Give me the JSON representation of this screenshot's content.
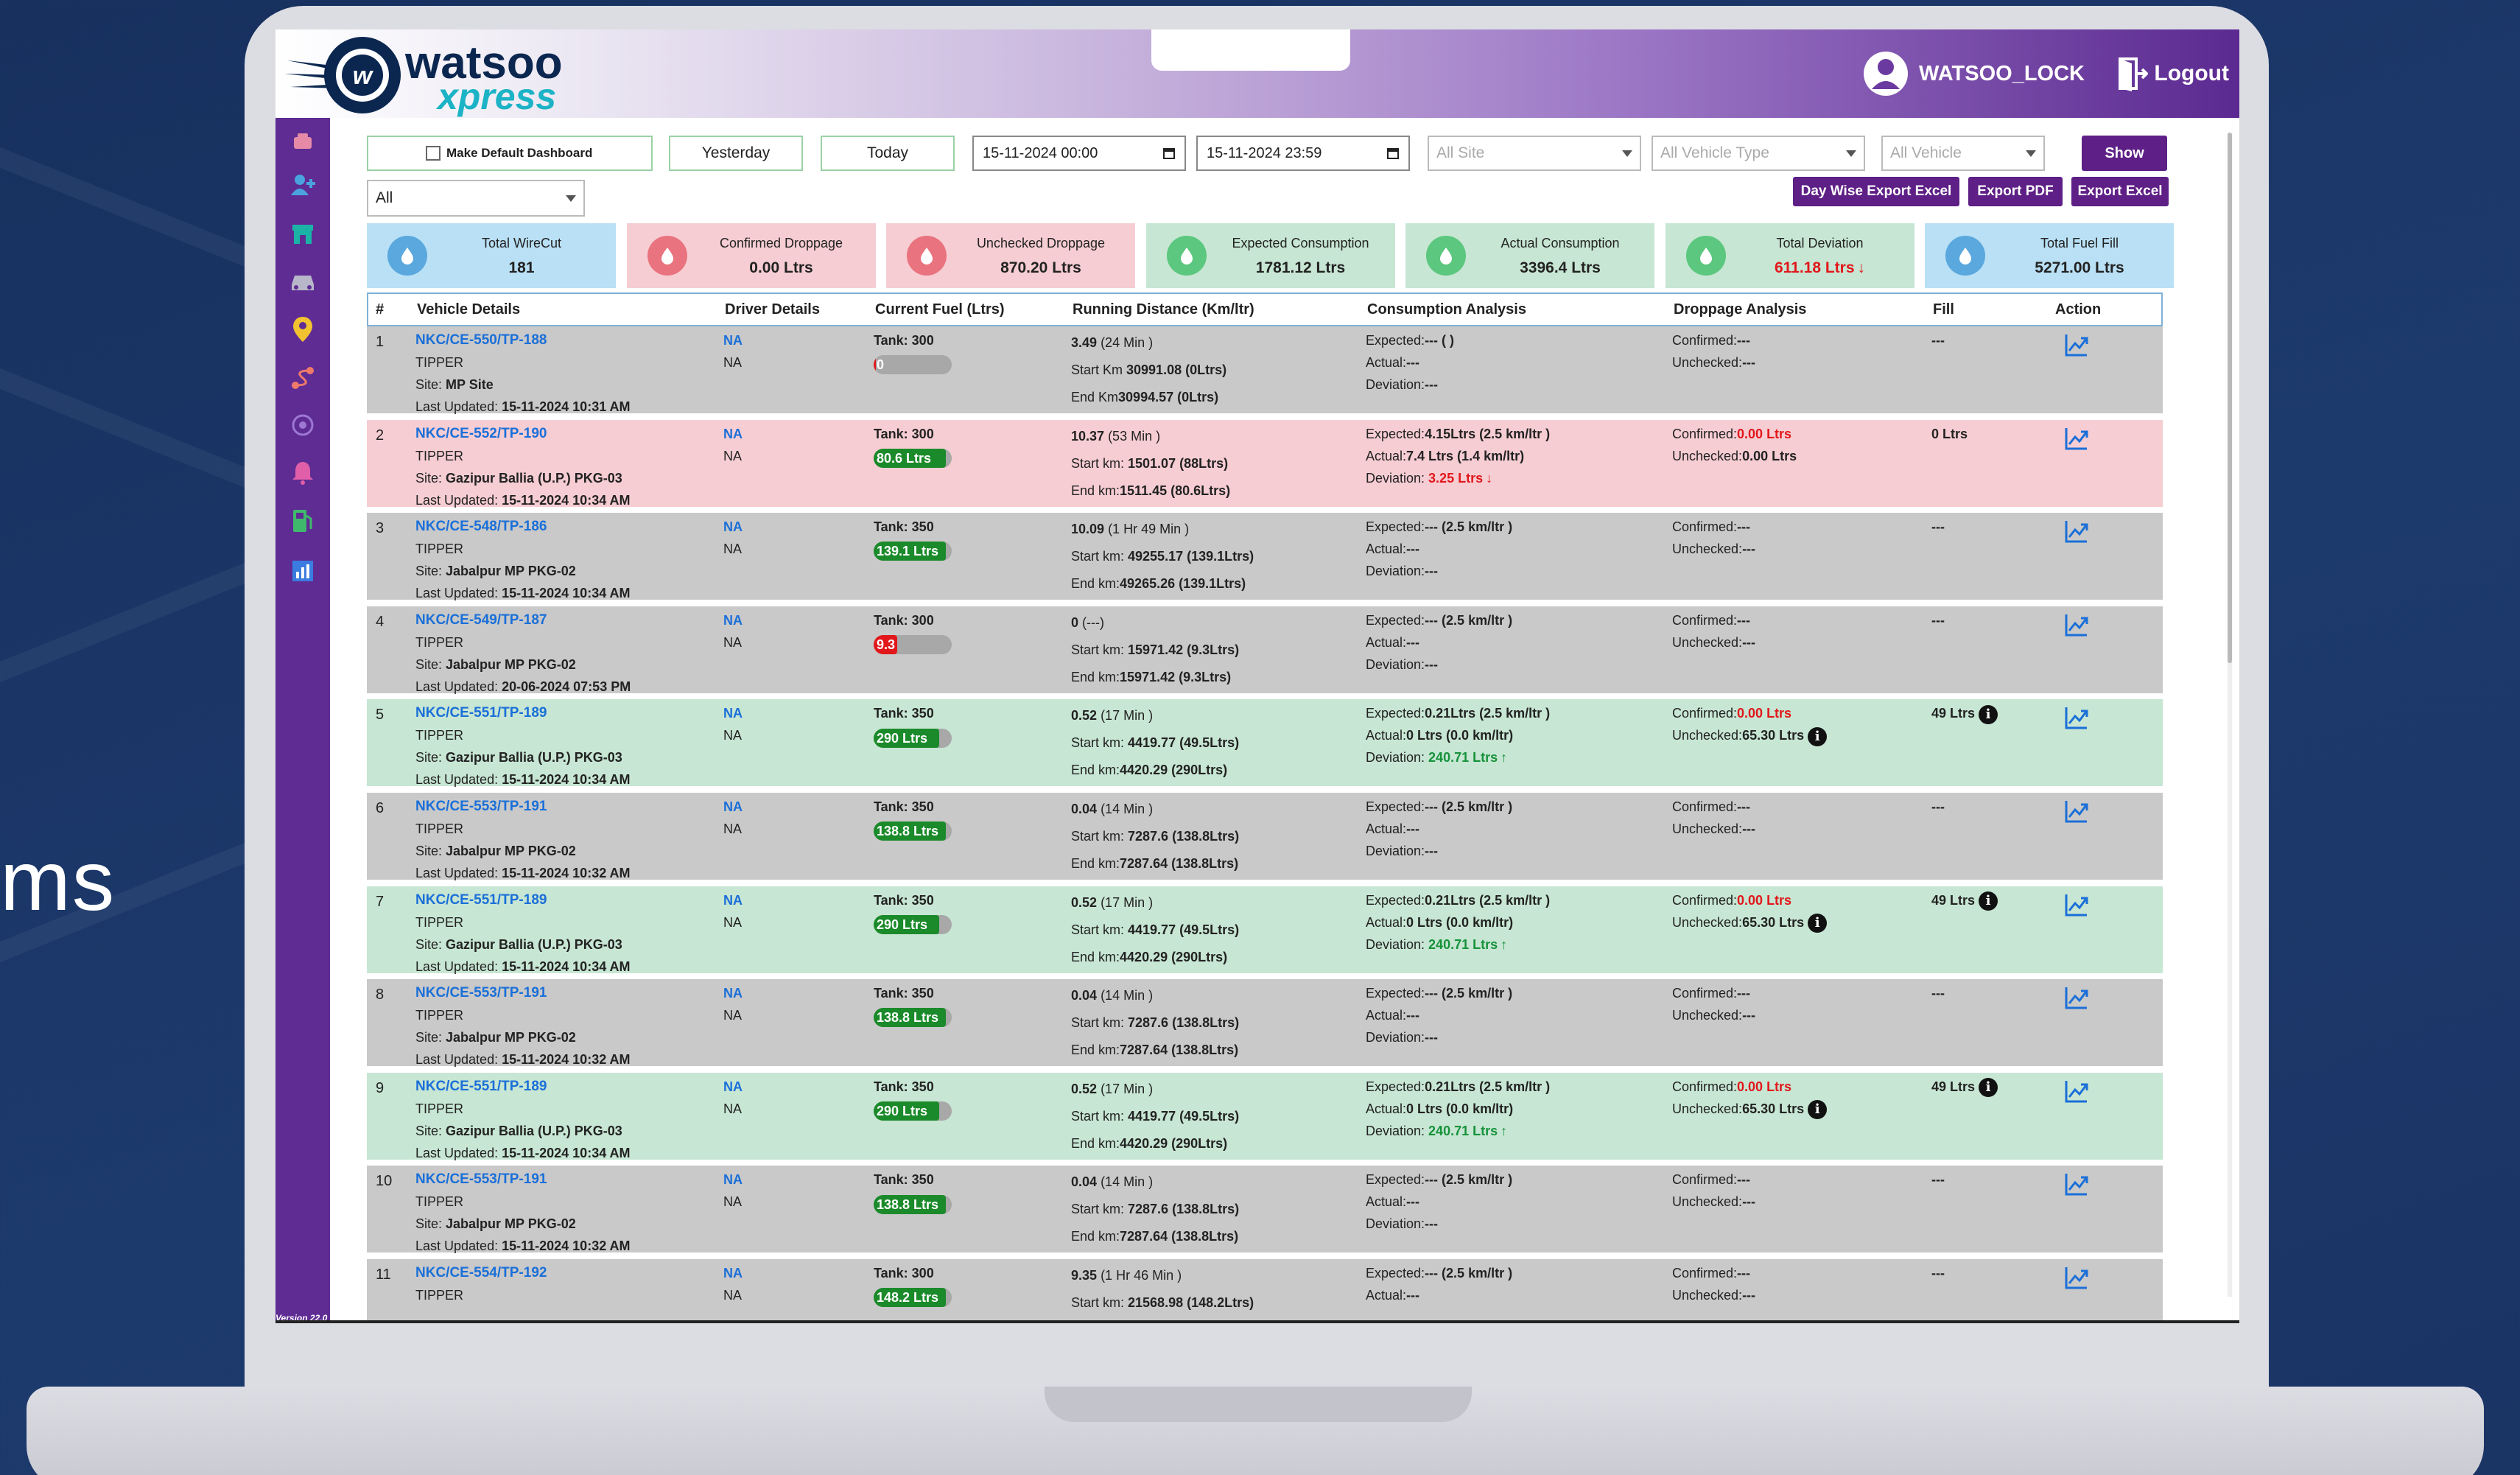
{
  "background": {
    "side_text": "ms"
  },
  "header": {
    "logo_brand": "watsoo",
    "logo_sub": "xpress",
    "username": "WATSOO_LOCK",
    "logout_label": "Logout"
  },
  "sidebar": {
    "version": "Version 22.0"
  },
  "filters": {
    "make_default_label": "Make Default Dashboard",
    "yesterday_label": "Yesterday",
    "today_label": "Today",
    "from_datetime": "15-11-2024 00:00",
    "to_datetime": "15-11-2024 23:59",
    "site_placeholder": "All Site",
    "vehicle_type_placeholder": "All Vehicle Type",
    "vehicle_placeholder": "All Vehicle",
    "show_label": "Show",
    "group_value": "All",
    "day_wise_export_label": "Day Wise Export Excel",
    "export_pdf_label": "Export PDF",
    "export_excel_label": "Export Excel"
  },
  "summary_cards": [
    {
      "title": "Total WireCut",
      "value": "181",
      "bg": "#b9e0f5",
      "icon_color": "#5aa8dd",
      "icon": "cable-icon"
    },
    {
      "title": "Confirmed Droppage",
      "value": "0.00 Ltrs",
      "bg": "#f6cdd3",
      "icon_color": "#e9737e",
      "icon": "fuel-drop-icon"
    },
    {
      "title": "Unchecked Droppage",
      "value": "870.20 Ltrs",
      "bg": "#f6cdd3",
      "icon_color": "#e9737e",
      "icon": "fuel-drop-icon"
    },
    {
      "title": "Expected Consumption",
      "value": "1781.12 Ltrs",
      "bg": "#c7e6d3",
      "icon_color": "#5cc77e",
      "icon": "fuel-pump-icon"
    },
    {
      "title": "Actual Consumption",
      "value": "3396.4 Ltrs",
      "bg": "#c7e6d3",
      "icon_color": "#5cc77e",
      "icon": "fuel-pump-icon"
    },
    {
      "title": "Total Deviation",
      "value": "611.18 Ltrs",
      "value_color": "#e1171b",
      "bg": "#c7e6d3",
      "icon_color": "#5cc77e",
      "icon": "fuel-pump-icon"
    },
    {
      "title": "Total Fuel Fill",
      "value": "5271.00 Ltrs",
      "bg": "#b9e0f5",
      "icon_color": "#5aa8dd",
      "icon": "water-drop-icon"
    }
  ],
  "table": {
    "columns": [
      "#",
      "Vehicle Details",
      "Driver Details",
      "Current Fuel (Ltrs)",
      "Running Distance (Km/ltr)",
      "Consumption Analysis",
      "Droppage Analysis",
      "Fill",
      "Action"
    ],
    "rows": [
      {
        "num": "1",
        "status": "gray",
        "vehicle": "NKC/CE-550/TP-188",
        "type": "TIPPER",
        "site_label": "Site: ",
        "site": "MP Site",
        "updated_label": "Last Updated: ",
        "updated": "15-11-2024 10:31 AM",
        "driver": "NA",
        "driver_sub": "NA",
        "tank": "Tank: 300",
        "fuel": "0",
        "fuel_pct": 0.03,
        "fuel_color": "#e1171b",
        "dist": "3.49",
        "dist_time": "(24 Min )",
        "start_label": "Start Km ",
        "start": "30991.08 (0Ltrs)",
        "end_label": "End Km",
        "end": "30994.57 (0Ltrs)",
        "expected_label": "Expected:",
        "expected": "--- ( )",
        "actual_label": "Actual:",
        "actual": "---",
        "deviation_label": "Deviation:",
        "deviation": "---",
        "deviation_dir": "",
        "confirmed_label": "Confirmed:",
        "confirmed": "---",
        "confirmed_red": false,
        "unchecked_label": "Unchecked:",
        "unchecked": "---",
        "unchecked_info": false,
        "fill": "---",
        "fill_info": false
      },
      {
        "num": "2",
        "status": "pink",
        "vehicle": "NKC/CE-552/TP-190",
        "type": "TIPPER",
        "site_label": "Site: ",
        "site": "Gazipur Ballia (U.P.) PKG-03",
        "updated_label": "Last Updated: ",
        "updated": "15-11-2024 10:34 AM",
        "driver": "NA",
        "driver_sub": "NA",
        "tank": "Tank: 300",
        "fuel": "80.6 Ltrs",
        "fuel_pct": 0.92,
        "fuel_color": "#1b8a2a",
        "dist": "10.37",
        "dist_time": "(53 Min )",
        "start_label": "Start km: ",
        "start": "1501.07 (88Ltrs)",
        "end_label": "End km:",
        "end": "1511.45 (80.6Ltrs)",
        "expected_label": "Expected:",
        "expected": "4.15Ltrs (2.5 km/ltr )",
        "actual_label": "Actual:",
        "actual": "7.4 Ltrs (1.4 km/ltr)",
        "deviation_label": "Deviation: ",
        "deviation": "3.25 Ltrs",
        "deviation_dir": "down",
        "confirmed_label": "Confirmed:",
        "confirmed": "0.00 Ltrs",
        "confirmed_red": true,
        "unchecked_label": "Unchecked:",
        "unchecked": "0.00 Ltrs",
        "unchecked_info": false,
        "fill": "0 Ltrs",
        "fill_info": false
      },
      {
        "num": "3",
        "status": "gray",
        "vehicle": "NKC/CE-548/TP-186",
        "type": "TIPPER",
        "site_label": "Site: ",
        "site": "Jabalpur MP PKG-02",
        "updated_label": "Last Updated: ",
        "updated": "15-11-2024 10:34 AM",
        "driver": "NA",
        "driver_sub": "NA",
        "tank": "Tank: 350",
        "fuel": "139.1 Ltrs",
        "fuel_pct": 0.92,
        "fuel_color": "#1b8a2a",
        "dist": "10.09",
        "dist_time": "(1 Hr 49 Min )",
        "start_label": "Start km: ",
        "start": "49255.17 (139.1Ltrs)",
        "end_label": "End km:",
        "end": "49265.26 (139.1Ltrs)",
        "expected_label": "Expected:",
        "expected": "--- (2.5 km/ltr )",
        "actual_label": "Actual:",
        "actual": "---",
        "deviation_label": "Deviation:",
        "deviation": "---",
        "deviation_dir": "",
        "confirmed_label": "Confirmed:",
        "confirmed": "---",
        "confirmed_red": false,
        "unchecked_label": "Unchecked:",
        "unchecked": "---",
        "unchecked_info": false,
        "fill": "---",
        "fill_info": false
      },
      {
        "num": "4",
        "status": "gray",
        "vehicle": "NKC/CE-549/TP-187",
        "type": "TIPPER",
        "site_label": "Site: ",
        "site": "Jabalpur MP PKG-02",
        "updated_label": "Last Updated: ",
        "updated": "20-06-2024 07:53 PM",
        "driver": "NA",
        "driver_sub": "NA",
        "tank": "Tank: 300",
        "fuel": "9.3",
        "fuel_pct": 0.3,
        "fuel_color": "#e1171b",
        "dist": "0",
        "dist_time": "(---)",
        "start_label": "Start km: ",
        "start": "15971.42 (9.3Ltrs)",
        "end_label": "End km:",
        "end": "15971.42 (9.3Ltrs)",
        "expected_label": "Expected:",
        "expected": "--- (2.5 km/ltr )",
        "actual_label": "Actual:",
        "actual": "---",
        "deviation_label": "Deviation:",
        "deviation": "---",
        "deviation_dir": "",
        "confirmed_label": "Confirmed:",
        "confirmed": "---",
        "confirmed_red": false,
        "unchecked_label": "Unchecked:",
        "unchecked": "---",
        "unchecked_info": false,
        "fill": "---",
        "fill_info": false
      },
      {
        "num": "5",
        "status": "green",
        "vehicle": "NKC/CE-551/TP-189",
        "type": "TIPPER",
        "site_label": "Site: ",
        "site": "Gazipur Ballia (U.P.) PKG-03",
        "updated_label": "Last Updated: ",
        "updated": "15-11-2024 10:34 AM",
        "driver": "NA",
        "driver_sub": "NA",
        "tank": "Tank: 350",
        "fuel": "290 Ltrs",
        "fuel_pct": 0.84,
        "fuel_color": "#1b8a2a",
        "dist": "0.52",
        "dist_time": "(17 Min )",
        "start_label": "Start km: ",
        "start": "4419.77 (49.5Ltrs)",
        "end_label": "End km:",
        "end": "4420.29 (290Ltrs)",
        "expected_label": "Expected:",
        "expected": "0.21Ltrs (2.5 km/ltr )",
        "actual_label": "Actual:",
        "actual": "0 Ltrs (0.0 km/ltr)",
        "deviation_label": "Deviation: ",
        "deviation": "240.71 Ltrs",
        "deviation_dir": "up",
        "confirmed_label": "Confirmed:",
        "confirmed": "0.00 Ltrs",
        "confirmed_red": true,
        "unchecked_label": "Unchecked:",
        "unchecked": "65.30 Ltrs",
        "unchecked_info": true,
        "fill": "49 Ltrs",
        "fill_info": true
      },
      {
        "num": "6",
        "status": "gray",
        "vehicle": "NKC/CE-553/TP-191",
        "type": "TIPPER",
        "site_label": "Site: ",
        "site": "Jabalpur MP PKG-02",
        "updated_label": "Last Updated: ",
        "updated": "15-11-2024 10:32 AM",
        "driver": "NA",
        "driver_sub": "NA",
        "tank": "Tank: 350",
        "fuel": "138.8 Ltrs",
        "fuel_pct": 0.92,
        "fuel_color": "#1b8a2a",
        "dist": "0.04",
        "dist_time": "(14 Min )",
        "start_label": "Start km: ",
        "start": "7287.6 (138.8Ltrs)",
        "end_label": "End km:",
        "end": "7287.64 (138.8Ltrs)",
        "expected_label": "Expected:",
        "expected": "--- (2.5 km/ltr )",
        "actual_label": "Actual:",
        "actual": "---",
        "deviation_label": "Deviation:",
        "deviation": "---",
        "deviation_dir": "",
        "confirmed_label": "Confirmed:",
        "confirmed": "---",
        "confirmed_red": false,
        "unchecked_label": "Unchecked:",
        "unchecked": "---",
        "unchecked_info": false,
        "fill": "---",
        "fill_info": false
      },
      {
        "num": "7",
        "status": "green",
        "vehicle": "NKC/CE-551/TP-189",
        "type": "TIPPER",
        "site_label": "Site: ",
        "site": "Gazipur Ballia (U.P.) PKG-03",
        "updated_label": "Last Updated: ",
        "updated": "15-11-2024 10:34 AM",
        "driver": "NA",
        "driver_sub": "NA",
        "tank": "Tank: 350",
        "fuel": "290 Ltrs",
        "fuel_pct": 0.84,
        "fuel_color": "#1b8a2a",
        "dist": "0.52",
        "dist_time": "(17 Min )",
        "start_label": "Start km: ",
        "start": "4419.77 (49.5Ltrs)",
        "end_label": "End km:",
        "end": "4420.29 (290Ltrs)",
        "expected_label": "Expected:",
        "expected": "0.21Ltrs (2.5 km/ltr )",
        "actual_label": "Actual:",
        "actual": "0 Ltrs (0.0 km/ltr)",
        "deviation_label": "Deviation: ",
        "deviation": "240.71 Ltrs",
        "deviation_dir": "up",
        "confirmed_label": "Confirmed:",
        "confirmed": "0.00 Ltrs",
        "confirmed_red": true,
        "unchecked_label": "Unchecked:",
        "unchecked": "65.30 Ltrs",
        "unchecked_info": true,
        "fill": "49 Ltrs",
        "fill_info": true
      },
      {
        "num": "8",
        "status": "gray",
        "vehicle": "NKC/CE-553/TP-191",
        "type": "TIPPER",
        "site_label": "Site: ",
        "site": "Jabalpur MP PKG-02",
        "updated_label": "Last Updated: ",
        "updated": "15-11-2024 10:32 AM",
        "driver": "NA",
        "driver_sub": "NA",
        "tank": "Tank: 350",
        "fuel": "138.8 Ltrs",
        "fuel_pct": 0.92,
        "fuel_color": "#1b8a2a",
        "dist": "0.04",
        "dist_time": "(14 Min )",
        "start_label": "Start km: ",
        "start": "7287.6 (138.8Ltrs)",
        "end_label": "End km:",
        "end": "7287.64 (138.8Ltrs)",
        "expected_label": "Expected:",
        "expected": "--- (2.5 km/ltr )",
        "actual_label": "Actual:",
        "actual": "---",
        "deviation_label": "Deviation:",
        "deviation": "---",
        "deviation_dir": "",
        "confirmed_label": "Confirmed:",
        "confirmed": "---",
        "confirmed_red": false,
        "unchecked_label": "Unchecked:",
        "unchecked": "---",
        "unchecked_info": false,
        "fill": "---",
        "fill_info": false
      },
      {
        "num": "9",
        "status": "green",
        "vehicle": "NKC/CE-551/TP-189",
        "type": "TIPPER",
        "site_label": "Site: ",
        "site": "Gazipur Ballia (U.P.) PKG-03",
        "updated_label": "Last Updated: ",
        "updated": "15-11-2024 10:34 AM",
        "driver": "NA",
        "driver_sub": "NA",
        "tank": "Tank: 350",
        "fuel": "290 Ltrs",
        "fuel_pct": 0.84,
        "fuel_color": "#1b8a2a",
        "dist": "0.52",
        "dist_time": "(17 Min )",
        "start_label": "Start km: ",
        "start": "4419.77 (49.5Ltrs)",
        "end_label": "End km:",
        "end": "4420.29 (290Ltrs)",
        "expected_label": "Expected:",
        "expected": "0.21Ltrs (2.5 km/ltr )",
        "actual_label": "Actual:",
        "actual": "0 Ltrs (0.0 km/ltr)",
        "deviation_label": "Deviation: ",
        "deviation": "240.71 Ltrs",
        "deviation_dir": "up",
        "confirmed_label": "Confirmed:",
        "confirmed": "0.00 Ltrs",
        "confirmed_red": true,
        "unchecked_label": "Unchecked:",
        "unchecked": "65.30 Ltrs",
        "unchecked_info": true,
        "fill": "49 Ltrs",
        "fill_info": true
      },
      {
        "num": "10",
        "status": "gray",
        "vehicle": "NKC/CE-553/TP-191",
        "type": "TIPPER",
        "site_label": "Site: ",
        "site": "Jabalpur MP PKG-02",
        "updated_label": "Last Updated: ",
        "updated": "15-11-2024 10:32 AM",
        "driver": "NA",
        "driver_sub": "NA",
        "tank": "Tank: 350",
        "fuel": "138.8 Ltrs",
        "fuel_pct": 0.92,
        "fuel_color": "#1b8a2a",
        "dist": "0.04",
        "dist_time": "(14 Min )",
        "start_label": "Start km: ",
        "start": "7287.6 (138.8Ltrs)",
        "end_label": "End km:",
        "end": "7287.64 (138.8Ltrs)",
        "expected_label": "Expected:",
        "expected": "--- (2.5 km/ltr )",
        "actual_label": "Actual:",
        "actual": "---",
        "deviation_label": "Deviation:",
        "deviation": "---",
        "deviation_dir": "",
        "confirmed_label": "Confirmed:",
        "confirmed": "---",
        "confirmed_red": false,
        "unchecked_label": "Unchecked:",
        "unchecked": "---",
        "unchecked_info": false,
        "fill": "---",
        "fill_info": false
      },
      {
        "num": "11",
        "status": "gray",
        "vehicle": "NKC/CE-554/TP-192",
        "type": "TIPPER",
        "site_label": "",
        "site": "",
        "updated_label": "",
        "updated": "",
        "driver": "NA",
        "driver_sub": "NA",
        "tank": "Tank: 300",
        "fuel": "148.2 Ltrs",
        "fuel_pct": 0.92,
        "fuel_color": "#1b8a2a",
        "dist": "9.35",
        "dist_time": "(1 Hr 46 Min )",
        "start_label": "Start km: ",
        "start": "21568.98 (148.2Ltrs)",
        "end_label": "",
        "end": "",
        "expected_label": "Expected:",
        "expected": "--- (2.5 km/ltr )",
        "actual_label": "Actual:",
        "actual": "---",
        "deviation_label": "",
        "deviation": "",
        "deviation_dir": "",
        "confirmed_label": "Confirmed:",
        "confirmed": "---",
        "confirmed_red": false,
        "unchecked_label": "Unchecked:",
        "unchecked": "---",
        "unchecked_info": false,
        "fill": "---",
        "fill_info": false
      }
    ]
  }
}
